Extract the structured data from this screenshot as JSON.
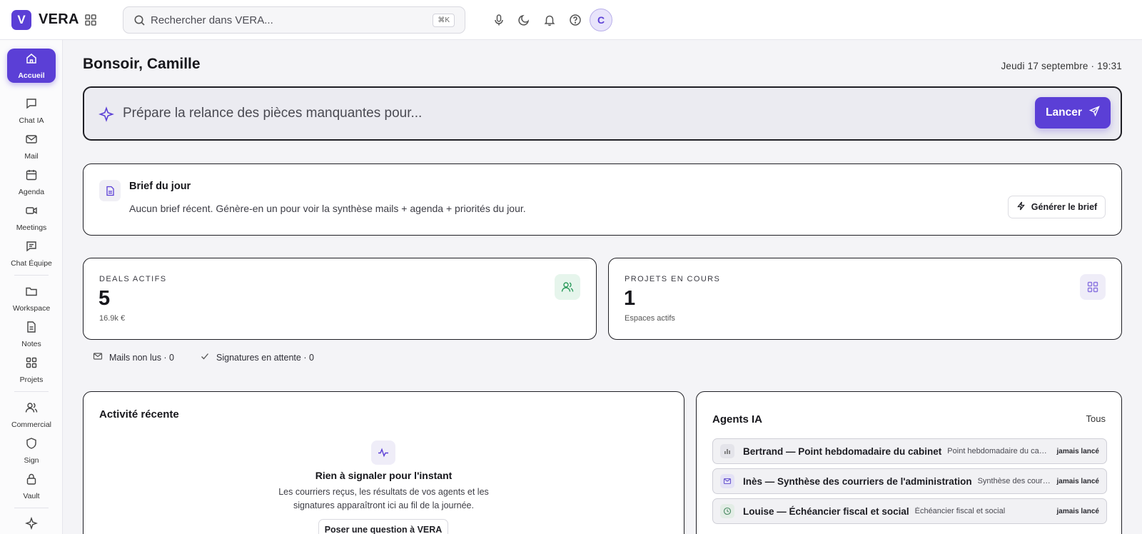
{
  "app": {
    "logo_letter": "V",
    "name": "VERA"
  },
  "search": {
    "placeholder": "Rechercher dans VERA...",
    "shortcut": "⌘K"
  },
  "top_icons": [
    "apps-grid-icon",
    "microphone-icon",
    "moon-icon",
    "bell-icon",
    "help-icon"
  ],
  "user": {
    "initial": "C"
  },
  "sidebar": {
    "items": [
      {
        "label": "Accueil",
        "icon": "home-icon",
        "active": true
      },
      {
        "label": "Chat IA",
        "icon": "chat-icon"
      },
      {
        "label": "Mail",
        "icon": "mail-icon"
      },
      {
        "label": "Agenda",
        "icon": "calendar-icon"
      },
      {
        "label": "Meetings",
        "icon": "video-icon"
      },
      {
        "label": "Chat Équipe",
        "icon": "team-chat-icon"
      },
      {
        "label": "Workspace",
        "icon": "folder-icon"
      },
      {
        "label": "Notes",
        "icon": "note-icon"
      },
      {
        "label": "Projets",
        "icon": "grid-icon"
      },
      {
        "label": "Commercial",
        "icon": "users-icon"
      },
      {
        "label": "Sign",
        "icon": "shield-icon"
      },
      {
        "label": "Vault",
        "icon": "lock-icon"
      }
    ]
  },
  "greeting": "Bonsoir, Camille",
  "datetime": "Jeudi 17 septembre · 19:31",
  "prompt": {
    "text": "Prépare la relance des pièces manquantes pour...",
    "button": "Lancer"
  },
  "brief": {
    "title": "Brief du jour",
    "text": "Aucun brief récent. Génère-en un pour voir la synthèse mails + agenda + priorités du jour.",
    "button": "Générer le brief"
  },
  "stats": [
    {
      "label": "DEALS ACTIFS",
      "value": "5",
      "sub": "16.9k €",
      "icon": "users-icon",
      "color": "#e6f5ec"
    },
    {
      "label": "PROJETS EN COURS",
      "value": "1",
      "sub": "Espaces actifs",
      "icon": "grid-icon",
      "color": "#efedf8"
    }
  ],
  "minis": [
    {
      "label": "Mails non lus · 0",
      "icon": "mail-icon"
    },
    {
      "label": "Signatures en attente · 0",
      "icon": "check-icon"
    }
  ],
  "activity": {
    "title": "Activité récente",
    "empty_title": "Rien à signaler pour l'instant",
    "empty_text": "Les courriers reçus, les résultats de vos agents et les signatures apparaîtront ici au fil de la journée.",
    "button": "Poser une question à VERA"
  },
  "agents": {
    "title": "Agents IA",
    "all_label": "Tous",
    "items": [
      {
        "name": "Bertrand — Point hebdomadaire du cabinet",
        "desc": "Point hebdomadaire du cabinet",
        "status": "jamais lancé",
        "icon": "bar-chart-icon"
      },
      {
        "name": "Inès — Synthèse des courriers de l'administration",
        "desc": "Synthèse des courriers de l'administration",
        "status": "jamais lancé",
        "icon": "mail-icon"
      },
      {
        "name": "Louise — Échéancier fiscal et social",
        "desc": "Échéancier fiscal et social",
        "status": "jamais lancé",
        "icon": "clock-icon"
      }
    ]
  },
  "colors": {
    "accent": "#5b3fd6",
    "deals_icon_bg": "#e6f5ec",
    "projets_icon_bg": "#efedf8"
  }
}
